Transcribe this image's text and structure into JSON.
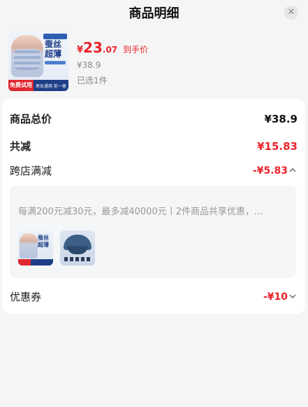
{
  "header": {
    "title": "商品明细",
    "close_icon": "✕"
  },
  "product": {
    "image_texts": {
      "line1": "蚕丝",
      "line2": "超薄",
      "badge": "免费试用",
      "badge_rest": "男女通用 前一留"
    },
    "price_symbol": "¥",
    "price_integer": "23",
    "price_decimal": ".07",
    "price_label": "到手价",
    "original_price": "¥38.9",
    "selected_count": "已选1件"
  },
  "summary": {
    "total_label": "商品总价",
    "total_value": "¥38.9",
    "reduction_label": "共减",
    "reduction_value": "¥15.83",
    "cross_store_label": "跨店满减",
    "cross_store_value": "-¥5.83",
    "cross_store_chevron": "^",
    "promo_text": "每满200元减30元，最多减40000元丨2件商品共享优惠，...",
    "promo_items": [
      {
        "name": "knee-sleeve",
        "text1": "蚕丝",
        "text2": "超薄"
      },
      {
        "name": "umbrella"
      }
    ],
    "coupon_label": "优惠券",
    "coupon_value": "-¥10",
    "coupon_chevron": "v"
  },
  "colors": {
    "accent": "#e8242b",
    "background": "#f5f5f5",
    "card": "#ffffff"
  }
}
